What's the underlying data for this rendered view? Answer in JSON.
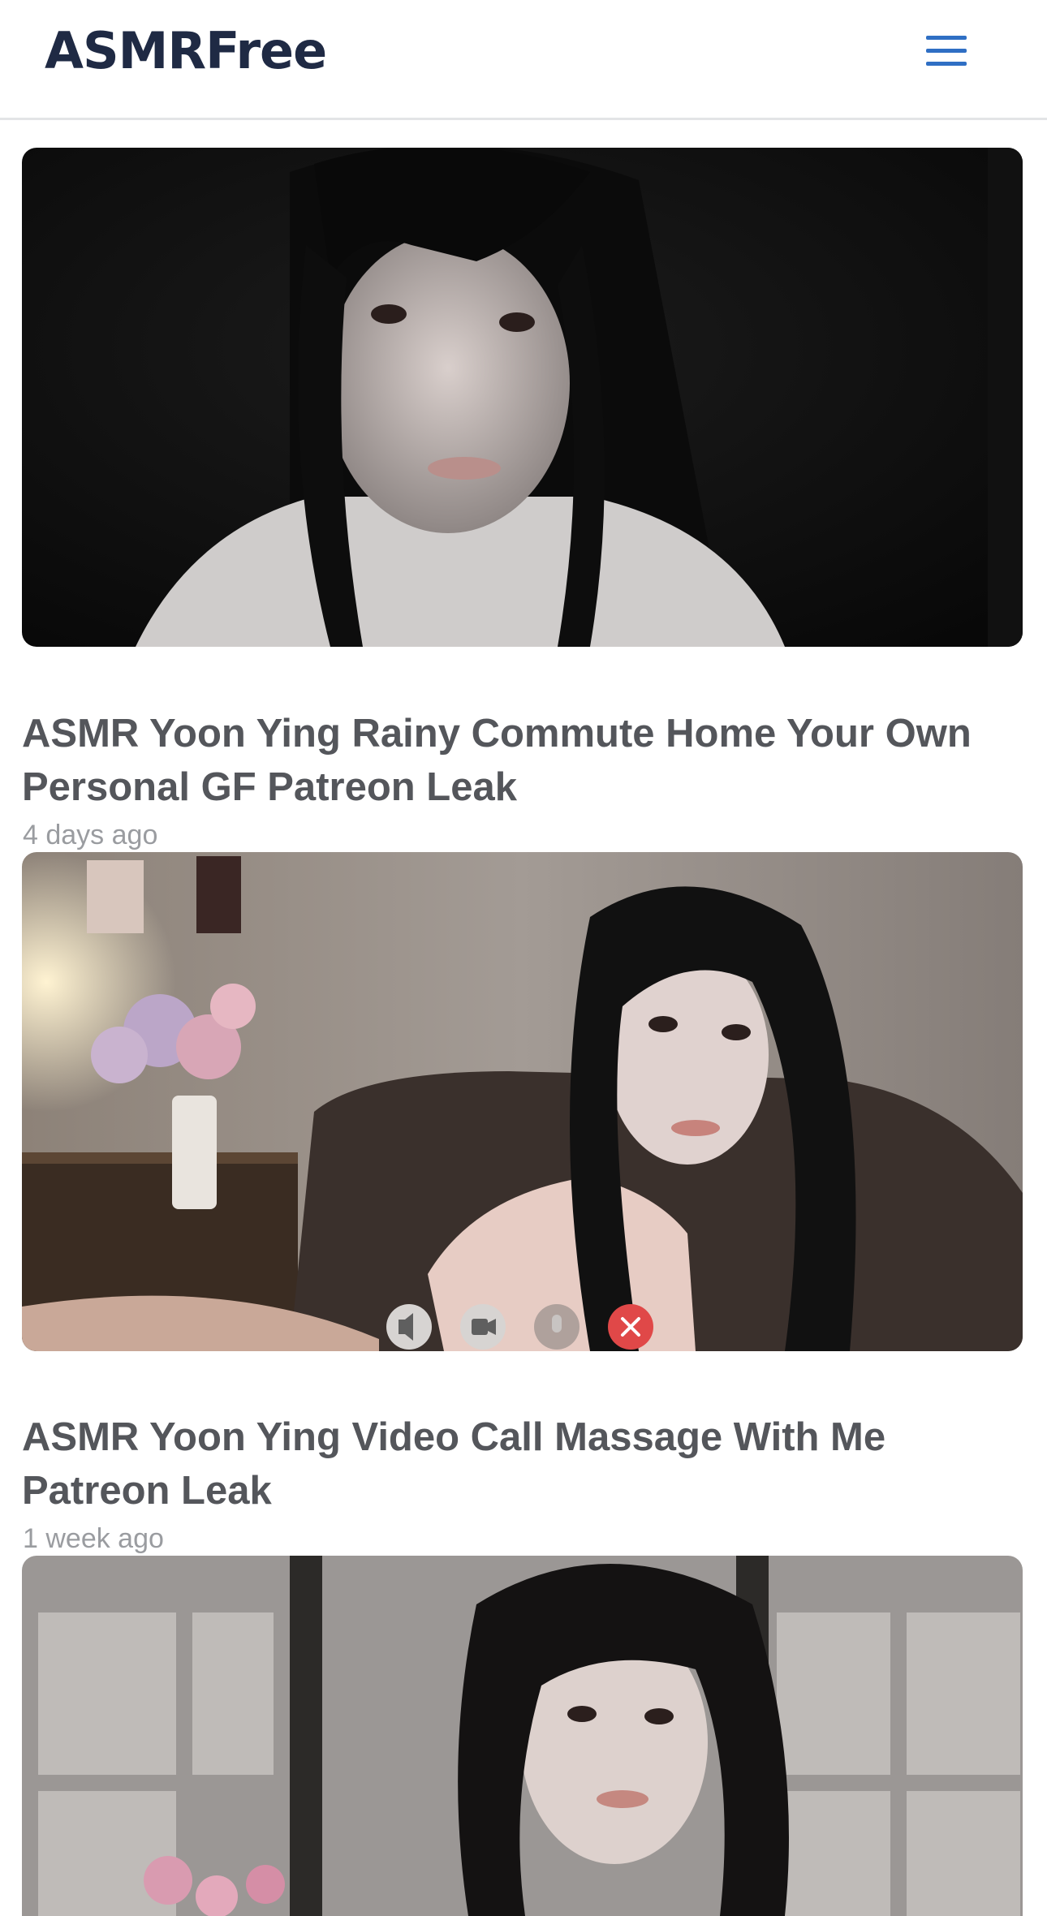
{
  "header": {
    "logo_text": "ASMRFree",
    "menu_icon": "hamburger-menu-icon"
  },
  "posts": [
    {
      "title": "",
      "time": "",
      "thumbnail": "dark-room-portrait-thumbnail"
    },
    {
      "title": "ASMR Yoon Ying Rainy Commute Home Your Own Personal GF Patreon Leak",
      "time": "4 days ago",
      "thumbnail": "video-call-portrait-thumbnail"
    },
    {
      "title": "ASMR Yoon Ying Video Call Massage With Me Patreon Leak",
      "time": "1 week ago",
      "thumbnail": "shoji-room-portrait-thumbnail"
    }
  ],
  "video_call_controls": [
    "speaker-icon",
    "camera-icon",
    "microphone-icon",
    "end-call-icon"
  ],
  "colors": {
    "logo": "#1f2a44",
    "menu_accent": "#2f6fc4",
    "title": "#54565b",
    "timestamp": "#9a9ca0",
    "end_call": "#e04848"
  }
}
